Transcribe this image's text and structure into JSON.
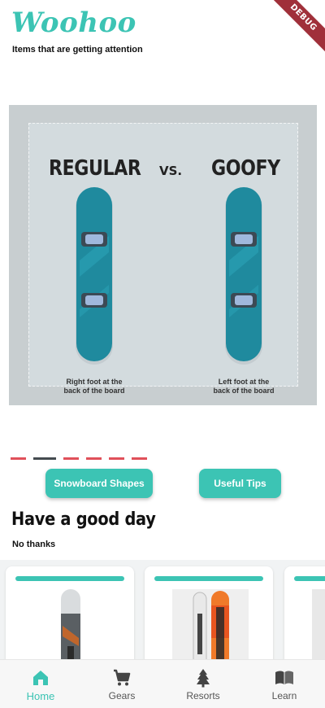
{
  "app": {
    "title": "Woohoo",
    "debug_banner": "DEBUG"
  },
  "header": {
    "subtitle": "Items that are getting attention"
  },
  "carousel": {
    "slide": {
      "left_title": "REGULAR",
      "vs": "VS.",
      "right_title": "GOOFY",
      "left_caption_line1": "Right foot at the",
      "left_caption_line2": "back of the board",
      "right_caption_line1": "Left foot at the",
      "right_caption_line2": "back of the board"
    },
    "page_count": 6,
    "active_page": 1
  },
  "actions": {
    "shapes_label": "Snowboard Shapes",
    "tips_label": "Useful Tips"
  },
  "greeting": {
    "title": "Have a good day",
    "dismiss": "No thanks"
  },
  "gear_cards": [
    {
      "image": "snowboard-photo"
    },
    {
      "image": "snowboard-pair-photo"
    },
    {
      "image": "snowboard-photo"
    }
  ],
  "bottom_nav": {
    "items": [
      {
        "label": "Home",
        "icon": "home-icon",
        "active": true
      },
      {
        "label": "Gears",
        "icon": "cart-icon",
        "active": false
      },
      {
        "label": "Resorts",
        "icon": "tree-icon",
        "active": false
      },
      {
        "label": "Learn",
        "icon": "book-icon",
        "active": false
      }
    ]
  },
  "colors": {
    "accent": "#3cc4b4",
    "indicator": "#e0505a",
    "indicator_active": "#444b4f",
    "board": "#1f8a9e"
  }
}
